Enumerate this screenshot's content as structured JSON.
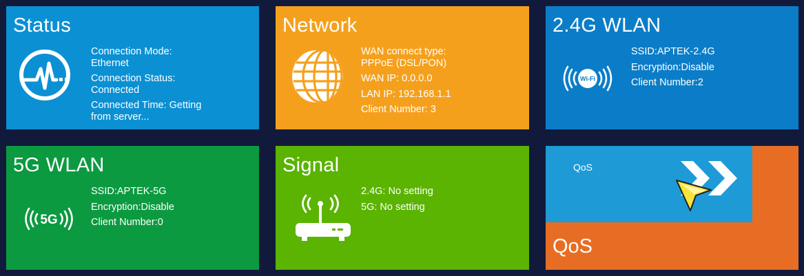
{
  "status": {
    "title": "Status",
    "icon": "heartbeat-icon",
    "lines": [
      "Connection Mode:",
      "Ethernet",
      "Connection Status:",
      "Connected",
      "Connected Time: Getting",
      "from server..."
    ]
  },
  "network": {
    "title": "Network",
    "icon": "globe-icon",
    "lines": [
      "WAN connect type:",
      "PPPoE (DSL/PON)",
      "WAN IP: 0.0.0.0",
      "LAN IP: 192.168.1.1",
      "Client Number: 3"
    ]
  },
  "wlan24": {
    "title": "2.4G WLAN",
    "icon": "wifi-signal-icon",
    "icon_label": "Wi-Fi",
    "lines": [
      "SSID:APTEK-2.4G",
      "Encryption:Disable",
      "Client Number:2"
    ]
  },
  "wlan5": {
    "title": "5G WLAN",
    "icon": "5g-signal-icon",
    "icon_label": "5G",
    "lines": [
      "SSID:APTEK-5G",
      "Encryption:Disable",
      "Client Number:0"
    ]
  },
  "signal": {
    "title": "Signal",
    "icon": "router-icon",
    "lines": [
      "2.4G: No setting",
      "5G: No setting"
    ]
  },
  "qos": {
    "title": "QoS",
    "small_label": "QoS",
    "icons": [
      "chevron-right-icon",
      "cursor-icon"
    ]
  },
  "colors": {
    "background": "#121a3b",
    "status": "#0b90d4",
    "network": "#f5a01d",
    "wlan24": "#0b7dc8",
    "wlan5": "#0c9a40",
    "signal": "#5ab401",
    "qos": "#e86d24",
    "qos_panel": "#1e9ad6"
  }
}
